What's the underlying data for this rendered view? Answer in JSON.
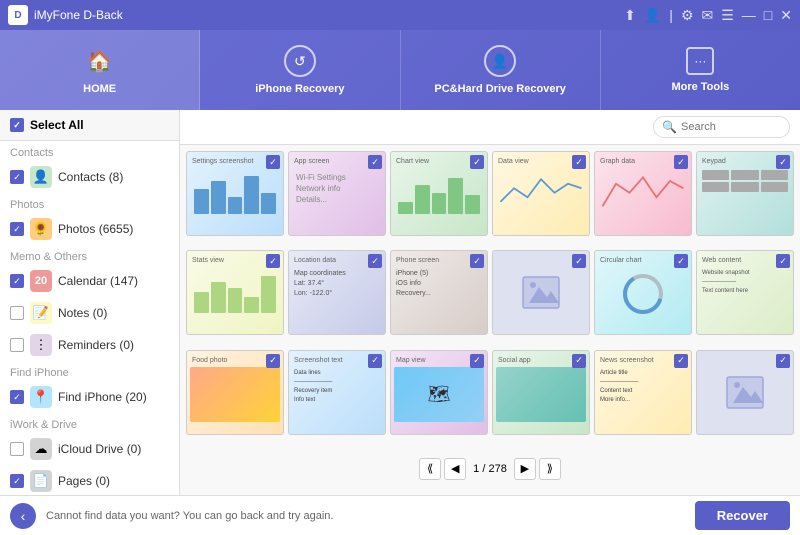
{
  "titleBar": {
    "logo": "D",
    "appName": "iMyFone D-Back",
    "icons": [
      "share",
      "user",
      "divider",
      "settings",
      "message",
      "menu",
      "minimize",
      "maximize",
      "close"
    ]
  },
  "nav": {
    "items": [
      {
        "id": "home",
        "label": "HOME",
        "icon": "🏠",
        "active": true
      },
      {
        "id": "iphone-recovery",
        "label": "iPhone Recovery",
        "icon": "↺",
        "active": false
      },
      {
        "id": "pc-drive",
        "label": "PC&Hard Drive Recovery",
        "icon": "👤",
        "active": false
      },
      {
        "id": "more-tools",
        "label": "More Tools",
        "icon": "···",
        "active": false
      }
    ]
  },
  "sidebar": {
    "selectAll": "Select All",
    "sections": [
      {
        "label": "Contacts",
        "items": [
          {
            "id": "contacts",
            "label": "Contacts (8)",
            "icon": "👤",
            "iconClass": "contacts",
            "checked": true
          }
        ]
      },
      {
        "label": "Photos",
        "items": [
          {
            "id": "photos",
            "label": "Photos (6655)",
            "icon": "🌻",
            "iconClass": "photos",
            "checked": true
          }
        ]
      },
      {
        "label": "Memo & Others",
        "items": [
          {
            "id": "calendar",
            "label": "Calendar (147)",
            "icon": "20",
            "iconClass": "calendar",
            "checked": true
          },
          {
            "id": "notes",
            "label": "Notes (0)",
            "icon": "📝",
            "iconClass": "notes",
            "checked": false
          },
          {
            "id": "reminders",
            "label": "Reminders (0)",
            "icon": "⋮",
            "iconClass": "reminders",
            "checked": false
          }
        ]
      },
      {
        "label": "Find iPhone",
        "items": [
          {
            "id": "findphone",
            "label": "Find iPhone (20)",
            "icon": "📍",
            "iconClass": "findphone",
            "checked": true
          }
        ]
      },
      {
        "label": "iWork & Drive",
        "items": [
          {
            "id": "icloud",
            "label": "iCloud Drive (0)",
            "icon": "☁",
            "iconClass": "icloud",
            "checked": false
          },
          {
            "id": "pages",
            "label": "Pages (0)",
            "icon": "📄",
            "iconClass": "pages",
            "checked": false
          }
        ]
      }
    ]
  },
  "toolbar": {
    "searchPlaceholder": "Search"
  },
  "bottomBar": {
    "message": "Cannot find data you want? You can go back and try again.",
    "recoverLabel": "Recover"
  },
  "pagination": {
    "current": "1",
    "total": "278"
  }
}
